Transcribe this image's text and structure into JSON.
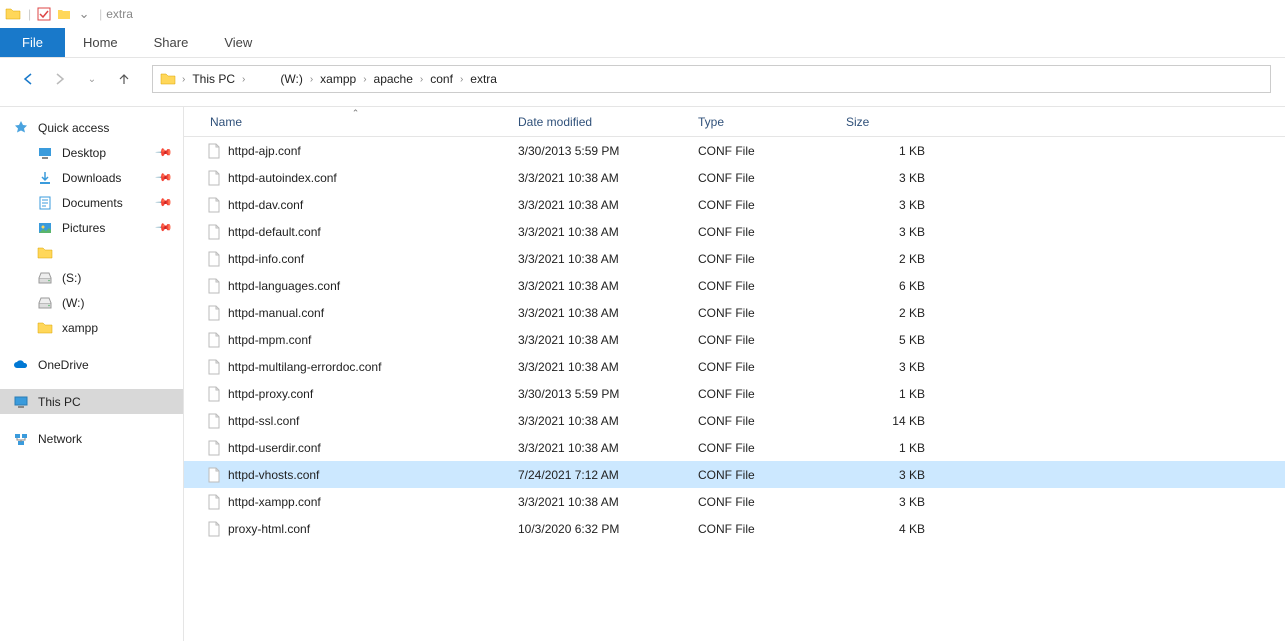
{
  "title": {
    "window_name": "extra"
  },
  "ribbon": {
    "file": "File",
    "tabs": [
      "Home",
      "Share",
      "View"
    ]
  },
  "breadcrumb": {
    "items": [
      "This PC",
      "(W:)",
      "xampp",
      "apache",
      "conf",
      "extra"
    ]
  },
  "sidebar": {
    "quick_access": "Quick access",
    "pinned": [
      {
        "label": "Desktop",
        "icon": "desktop"
      },
      {
        "label": "Downloads",
        "icon": "download"
      },
      {
        "label": "Documents",
        "icon": "document"
      },
      {
        "label": "Pictures",
        "icon": "picture"
      }
    ],
    "recent": [
      {
        "label": "",
        "icon": "folder"
      },
      {
        "label": "(S:)",
        "icon": "drive"
      },
      {
        "label": "(W:)",
        "icon": "drive"
      },
      {
        "label": "xampp",
        "icon": "folder"
      }
    ],
    "onedrive": "OneDrive",
    "thispc": "This PC",
    "network": "Network"
  },
  "columns": {
    "name": "Name",
    "date": "Date modified",
    "type": "Type",
    "size": "Size"
  },
  "files": [
    {
      "name": "httpd-ajp.conf",
      "date": "3/30/2013 5:59 PM",
      "type": "CONF File",
      "size": "1 KB"
    },
    {
      "name": "httpd-autoindex.conf",
      "date": "3/3/2021 10:38 AM",
      "type": "CONF File",
      "size": "3 KB"
    },
    {
      "name": "httpd-dav.conf",
      "date": "3/3/2021 10:38 AM",
      "type": "CONF File",
      "size": "3 KB"
    },
    {
      "name": "httpd-default.conf",
      "date": "3/3/2021 10:38 AM",
      "type": "CONF File",
      "size": "3 KB"
    },
    {
      "name": "httpd-info.conf",
      "date": "3/3/2021 10:38 AM",
      "type": "CONF File",
      "size": "2 KB"
    },
    {
      "name": "httpd-languages.conf",
      "date": "3/3/2021 10:38 AM",
      "type": "CONF File",
      "size": "6 KB"
    },
    {
      "name": "httpd-manual.conf",
      "date": "3/3/2021 10:38 AM",
      "type": "CONF File",
      "size": "2 KB"
    },
    {
      "name": "httpd-mpm.conf",
      "date": "3/3/2021 10:38 AM",
      "type": "CONF File",
      "size": "5 KB"
    },
    {
      "name": "httpd-multilang-errordoc.conf",
      "date": "3/3/2021 10:38 AM",
      "type": "CONF File",
      "size": "3 KB"
    },
    {
      "name": "httpd-proxy.conf",
      "date": "3/30/2013 5:59 PM",
      "type": "CONF File",
      "size": "1 KB"
    },
    {
      "name": "httpd-ssl.conf",
      "date": "3/3/2021 10:38 AM",
      "type": "CONF File",
      "size": "14 KB"
    },
    {
      "name": "httpd-userdir.conf",
      "date": "3/3/2021 10:38 AM",
      "type": "CONF File",
      "size": "1 KB"
    },
    {
      "name": "httpd-vhosts.conf",
      "date": "7/24/2021 7:12 AM",
      "type": "CONF File",
      "size": "3 KB",
      "selected": true
    },
    {
      "name": "httpd-xampp.conf",
      "date": "3/3/2021 10:38 AM",
      "type": "CONF File",
      "size": "3 KB"
    },
    {
      "name": "proxy-html.conf",
      "date": "10/3/2020 6:32 PM",
      "type": "CONF File",
      "size": "4 KB"
    }
  ]
}
